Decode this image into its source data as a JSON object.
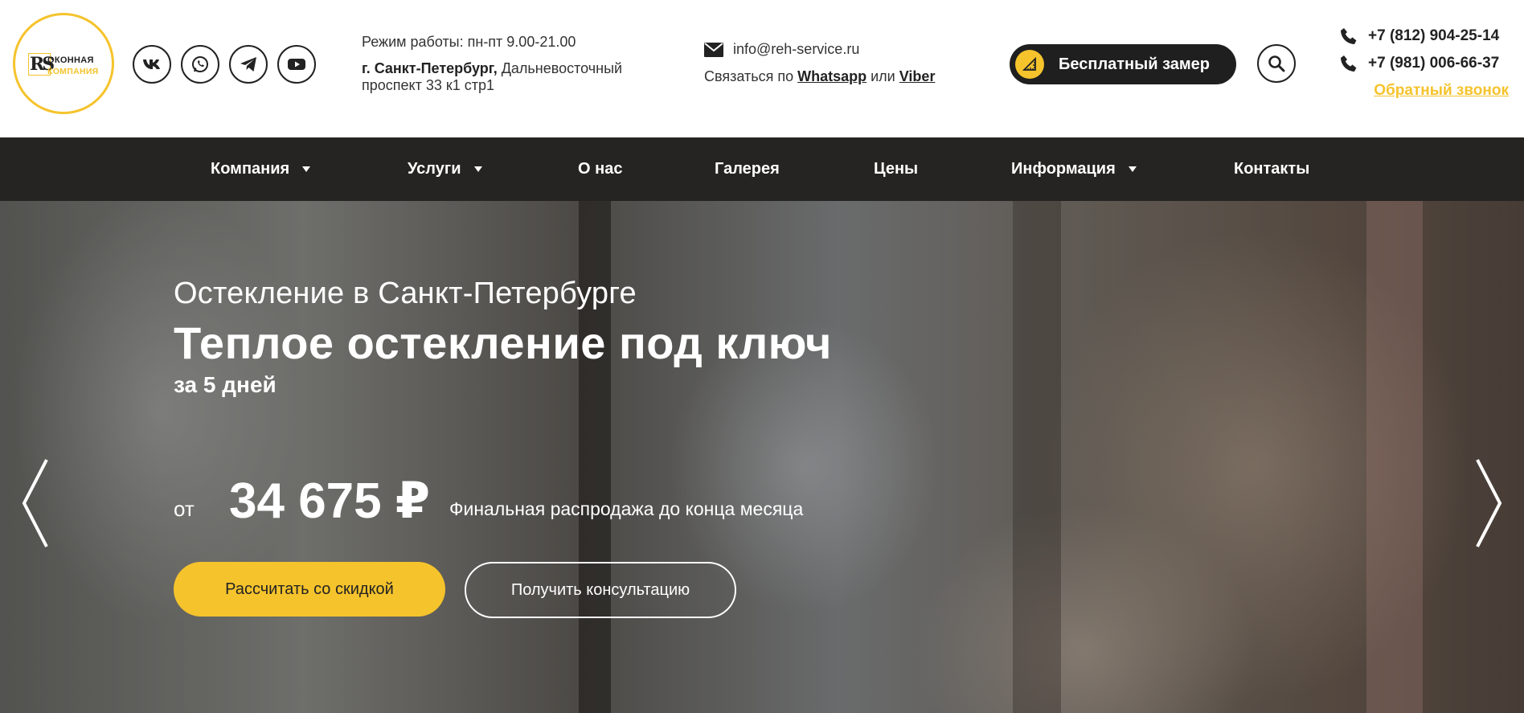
{
  "header": {
    "logo": {
      "line1": "ОКОННАЯ",
      "line2": "КОМПАНИЯ",
      "mark": "RS"
    },
    "social": [
      {
        "name": "vk-icon",
        "label": "VK"
      },
      {
        "name": "whatsapp-icon",
        "label": "WhatsApp"
      },
      {
        "name": "telegram-icon",
        "label": "Telegram"
      },
      {
        "name": "youtube-icon",
        "label": "YouTube"
      }
    ],
    "hours": "Режим работы: пн-пт 9.00-21.00",
    "address_city": "г. Санкт-Петербург,",
    "address_street": " Дальневосточный проспект 33 к1 стр1",
    "email": "info@reh-service.ru",
    "contact_prefix": "Связаться по ",
    "contact_whatsapp": "Whatsapp",
    "contact_or": " или ",
    "contact_viber": "Viber",
    "measure_button": "Бесплатный замер",
    "phones": [
      "+7 (812) 904-25-14",
      "+7 (981) 006-66-37"
    ],
    "callback": "Обратный звонок"
  },
  "nav": {
    "items": [
      {
        "label": "Компания",
        "dropdown": true
      },
      {
        "label": "Услуги",
        "dropdown": true
      },
      {
        "label": "О нас",
        "dropdown": false
      },
      {
        "label": "Галерея",
        "dropdown": false
      },
      {
        "label": "Цены",
        "dropdown": false
      },
      {
        "label": "Информация",
        "dropdown": true
      },
      {
        "label": "Контакты",
        "dropdown": false
      }
    ]
  },
  "hero": {
    "subtitle": "Остекление в Санкт-Петербурге",
    "title": "Теплое остекление под ключ",
    "days": "за 5 дней",
    "price_from": "от",
    "price": "34 675 ₽",
    "sale": "Финальная распродажа до конца месяца",
    "btn_primary": "Рассчитать со скидкой",
    "btn_secondary": "Получить консультацию"
  },
  "colors": {
    "accent": "#f5c32c",
    "dark": "#252422",
    "button_dark": "#1f1f1f"
  }
}
